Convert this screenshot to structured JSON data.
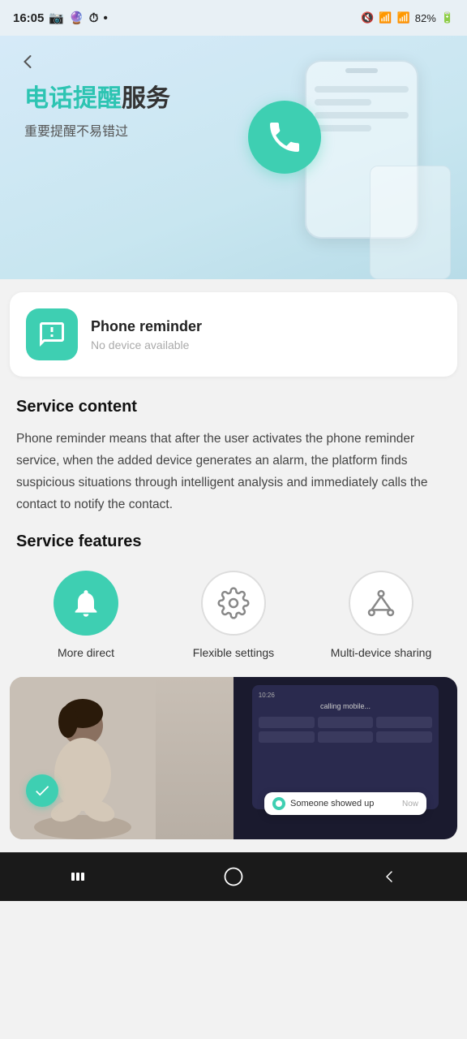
{
  "statusBar": {
    "time": "16:05",
    "battery": "82%"
  },
  "hero": {
    "titleCn1": "电话提醒",
    "titleCn2": "服务",
    "subtitleCn": "重要提醒不易错过"
  },
  "card": {
    "title": "Phone reminder",
    "subtitle": "No device available"
  },
  "serviceContent": {
    "sectionTitle": "Service content",
    "body": "Phone reminder means that after the user activates the phone reminder service, when the added device generates an alarm, the platform finds suspicious situations through intelligent analysis and immediately calls the contact to notify the contact."
  },
  "serviceFeatures": {
    "sectionTitle": "Service features",
    "items": [
      {
        "label": "More direct"
      },
      {
        "label": "Flexible settings"
      },
      {
        "label": "Multi-device sharing"
      }
    ]
  },
  "notification": {
    "text": "Someone showed up",
    "time": "Now"
  },
  "callLabel": "calling mobile..."
}
